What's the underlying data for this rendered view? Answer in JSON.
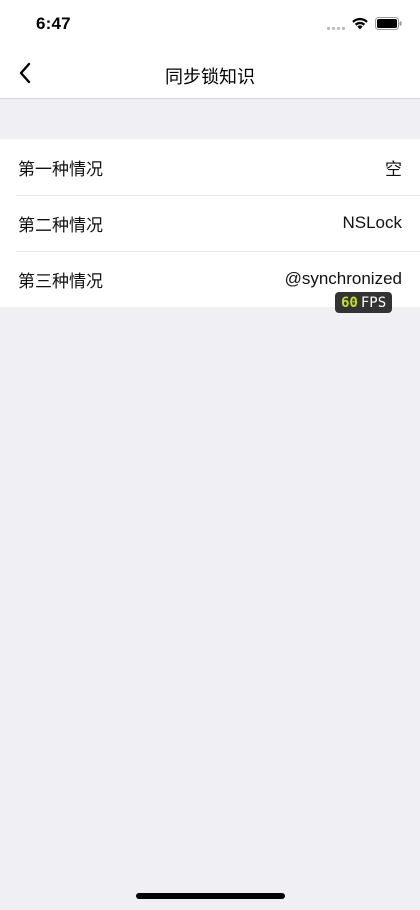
{
  "status_bar": {
    "time": "6:47",
    "signal_icon": "cellular-dots-icon",
    "wifi_icon": "wifi-icon",
    "battery_icon": "battery-icon"
  },
  "nav": {
    "back_icon": "chevron-left-icon",
    "title": "同步锁知识"
  },
  "list": {
    "items": [
      {
        "title": "第一种情况",
        "value": "空"
      },
      {
        "title": "第二种情况",
        "value": "NSLock"
      },
      {
        "title": "第三种情况",
        "value": "@synchronized"
      }
    ]
  },
  "fps": {
    "value": "60",
    "label": "FPS",
    "value_color": "#c6e028"
  },
  "colors": {
    "background": "#efeff4",
    "surface": "#ffffff"
  }
}
